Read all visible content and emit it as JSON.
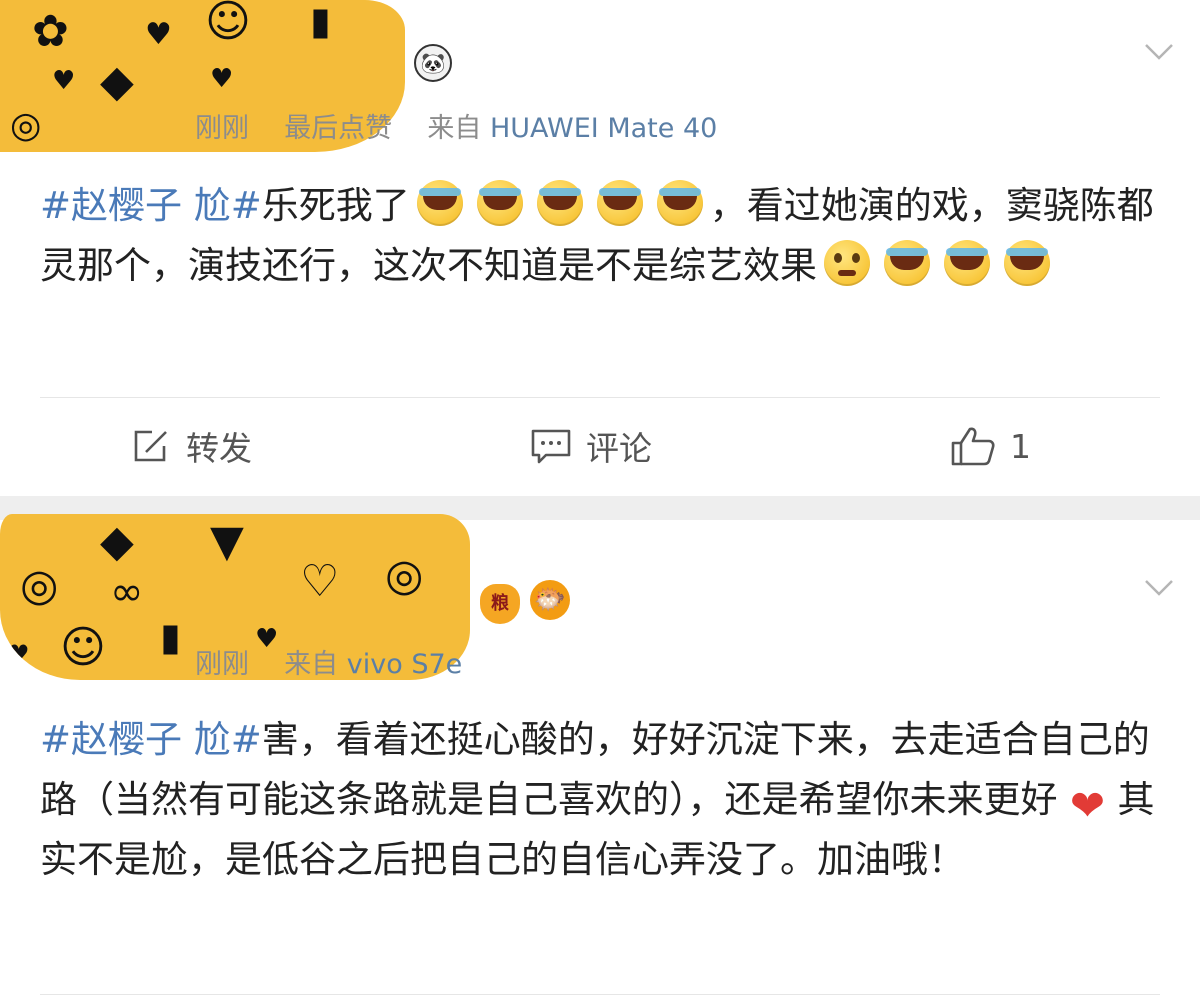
{
  "posts": [
    {
      "meta": {
        "time": "刚刚",
        "extra": "最后点赞",
        "source_prefix": "来自",
        "device": "HUAWEI Mate 40"
      },
      "content": {
        "hashtag": "#赵樱子 尬#",
        "line_a": "乐死我了",
        "line_b": "，看过她演的戏，窦骁陈都灵那个，演技还行，这次不知道是不是综艺效果"
      },
      "actions": {
        "repost_label": "转发",
        "comment_label": "评论",
        "like_count": "1"
      }
    },
    {
      "meta": {
        "time": "刚刚",
        "source_prefix": "来自",
        "device": "vivo S7e"
      },
      "content": {
        "hashtag": "#赵樱子 尬#",
        "line_a": "害，看着还挺心酸的，好好沉淀下来，去走适合自己的路（当然有可能这条路就是自己喜欢的），还是希望你未来更好",
        "line_b": "其实不是尬，是低谷之后把自己的自信心弄没了。加油哦！"
      },
      "badges": {
        "grain_label": "粮"
      }
    }
  ],
  "colors": {
    "hashtag": "#4a7ab8",
    "device": "#5b7fa6",
    "meta": "#8c8c8c",
    "sticker_bg": "#f4bc3a",
    "separator": "#eeeeee"
  },
  "icons": {
    "post1_badge": "panda-icon",
    "post2_badges": [
      "grain-bag-icon",
      "pufferfish-icon"
    ],
    "emoji_laugh": "laugh-cry-emoji",
    "emoji_think": "thinking-emoji",
    "emoji_heart": "heart-emoji"
  }
}
